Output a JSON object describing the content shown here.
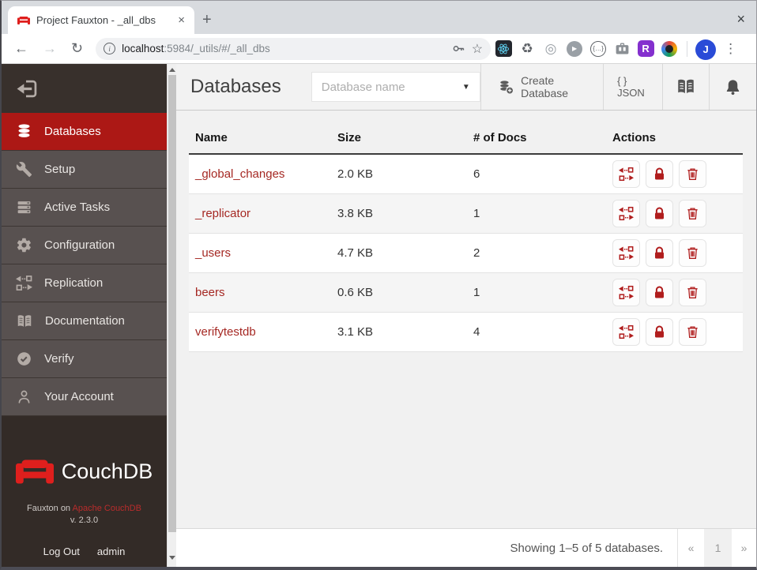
{
  "browser": {
    "tab_title": "Project Fauxton - _all_dbs",
    "url": {
      "host": "localhost",
      "path": ":5984/_utils/#/_all_dbs"
    },
    "avatar_initial": "J",
    "glyphs": {
      "close": "×",
      "new_tab": "+",
      "back": "←",
      "forward": "→",
      "reload": "↻",
      "star": "☆",
      "kebab": "⋮",
      "info": "i",
      "recycle": "♻",
      "orbit": "◎",
      "play": "▶",
      "braces": "{…}",
      "ext_r": "R"
    }
  },
  "sidebar": {
    "items": [
      {
        "label": "Databases"
      },
      {
        "label": "Setup"
      },
      {
        "label": "Active Tasks"
      },
      {
        "label": "Configuration"
      },
      {
        "label": "Replication"
      },
      {
        "label": "Documentation"
      },
      {
        "label": "Verify"
      },
      {
        "label": "Your Account"
      }
    ],
    "logo_text": "CouchDB",
    "footer_prefix": "Fauxton on ",
    "footer_link": "Apache CouchDB",
    "version": "v. 2.3.0",
    "logout": "Log Out",
    "username": "admin"
  },
  "header": {
    "title": "Databases",
    "search_placeholder": "Database name",
    "caret": "▼",
    "create_button": "Create Database",
    "json_button": "{ } JSON"
  },
  "table": {
    "columns": [
      "Name",
      "Size",
      "# of Docs",
      "Actions"
    ],
    "rows": [
      {
        "name": "_global_changes",
        "size": "2.0 KB",
        "docs": "6"
      },
      {
        "name": "_replicator",
        "size": "3.8 KB",
        "docs": "1"
      },
      {
        "name": "_users",
        "size": "4.7 KB",
        "docs": "2"
      },
      {
        "name": "beers",
        "size": "0.6 KB",
        "docs": "1"
      },
      {
        "name": "verifytestdb",
        "size": "3.1 KB",
        "docs": "4"
      }
    ]
  },
  "footer": {
    "summary": "Showing 1–5 of 5 databases.",
    "pagination": {
      "prev": "«",
      "page": "1",
      "next": "»"
    }
  },
  "colors": {
    "accent_red": "#ac1815",
    "link_red": "#a52823",
    "sidebar_bg": "#585150",
    "sidebar_dark": "#332b27",
    "logo_red": "#df1f1d"
  }
}
